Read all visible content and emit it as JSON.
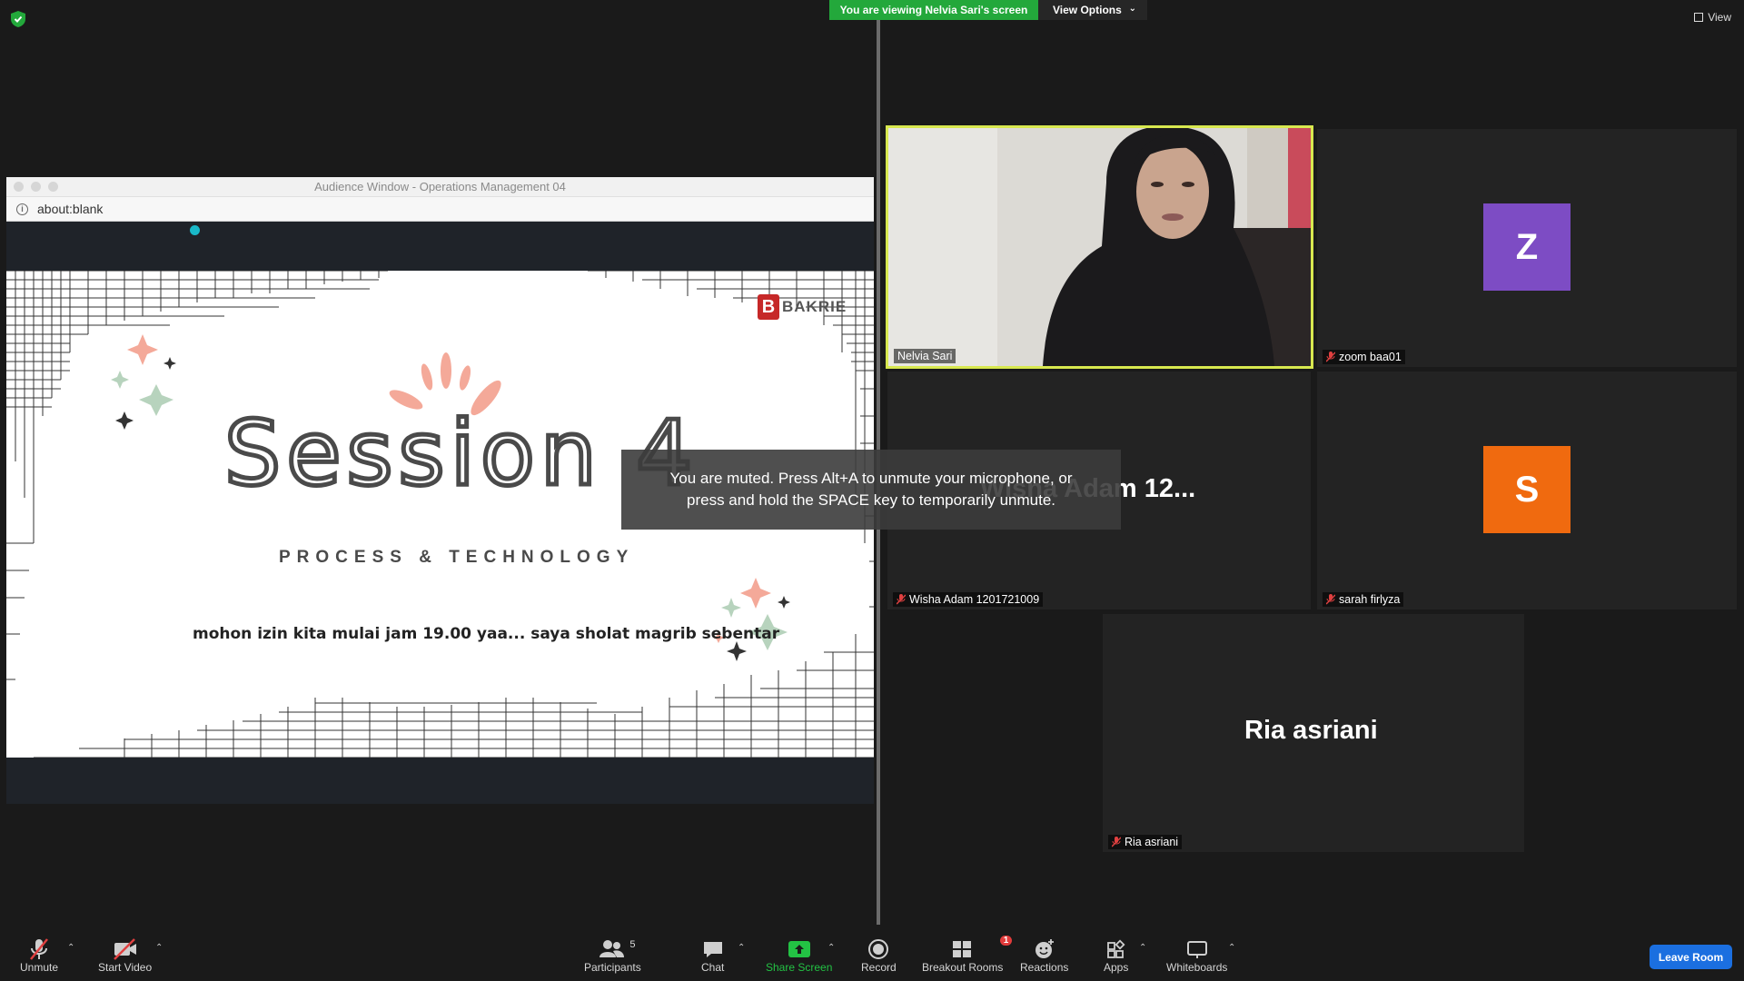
{
  "top_bar": {
    "viewing_banner": "You are viewing Nelvia Sari's screen",
    "view_options": "View Options",
    "view_button": "View"
  },
  "shared_window": {
    "title": "Audience Window - Operations Management 04",
    "url": "about:blank",
    "slide": {
      "title": "Session 4",
      "subtitle": "PROCESS & TECHNOLOGY",
      "message": "mohon izin kita mulai jam 19.00 yaa...  saya sholat magrib sebentar",
      "logo_text": "BAKRIE",
      "logo_mark": "B"
    }
  },
  "toast": {
    "line1": "You are muted. Press Alt+A to unmute your microphone, or",
    "line2": "press and hold the SPACE key to temporarily unmute."
  },
  "participants": [
    {
      "name": "Nelvia Sari",
      "type": "video",
      "active_speaker": true,
      "muted": false
    },
    {
      "name": "zoom baa01",
      "type": "avatar",
      "initial": "Z",
      "avatar_color": "#7d4cc4",
      "muted": true
    },
    {
      "name": "Wisha Adam 1201721009",
      "type": "name",
      "display": "Wisha Adam  12...",
      "muted": true
    },
    {
      "name": "sarah firlyza",
      "type": "avatar",
      "initial": "S",
      "avatar_color": "#f06a0f",
      "muted": true
    },
    {
      "name": "Ria asriani",
      "type": "name",
      "display": "Ria asriani",
      "muted": true
    }
  ],
  "toolbar": {
    "unmute": "Unmute",
    "start_video": "Start Video",
    "participants": "Participants",
    "participants_count": "5",
    "chat": "Chat",
    "share_screen": "Share Screen",
    "record": "Record",
    "breakout_rooms": "Breakout Rooms",
    "breakout_badge": "1",
    "reactions": "Reactions",
    "apps": "Apps",
    "whiteboards": "Whiteboards",
    "leave_room": "Leave Room"
  },
  "colors": {
    "viewing_banner": "#23a83b",
    "active_speaker_border": "#d8e84f",
    "leave_button": "#1b6fe0",
    "share_icon": "#23c244",
    "muted_red": "#e04040"
  }
}
